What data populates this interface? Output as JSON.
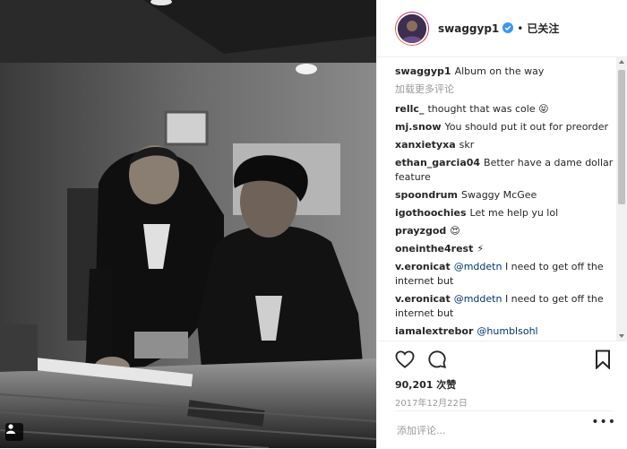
{
  "post": {
    "author": "swaggyp1",
    "follow_state": "已关注",
    "separator": "•",
    "load_more": "加载更多评论",
    "caption": {
      "user": "swaggyp1",
      "text": "Album on the way"
    },
    "comments": [
      {
        "user": "rellc_",
        "text": "thought that was cole 😝"
      },
      {
        "user": "mj.snow",
        "text": "You should put it out for preorder"
      },
      {
        "user": "xanxietyxa",
        "text": "skr"
      },
      {
        "user": "ethan_garcia04",
        "text": "Better have a dame dollar feature"
      },
      {
        "user": "spoondrum",
        "text": "Swaggy McGee"
      },
      {
        "user": "igothoochies",
        "text": "Let me help yu lol"
      },
      {
        "user": "prayzgod",
        "text": "😍"
      },
      {
        "user": "oneinthe4rest",
        "text": "⚡"
      },
      {
        "user": "v.eronicat",
        "mention": "@mddetn",
        "text": "I need to get off the internet but"
      },
      {
        "user": "v.eronicat",
        "mention": "@mddetn",
        "text": "I need to get off the internet but"
      },
      {
        "user": "iamalextrebor",
        "mention": "@humblsohl",
        "text": ""
      }
    ],
    "likes_count": "90,201",
    "likes_label": "次赞",
    "date": "2017年12月22日",
    "comment_placeholder": "添加评论...",
    "more_dots": "•••"
  },
  "icons": {
    "verified": "verified-badge-icon",
    "like": "heart-icon",
    "comment": "comment-bubble-icon",
    "save": "bookmark-icon",
    "tag": "person-tag-icon"
  },
  "colors": {
    "verified": "#3897f0",
    "mention": "#003569",
    "muted": "#999999"
  }
}
